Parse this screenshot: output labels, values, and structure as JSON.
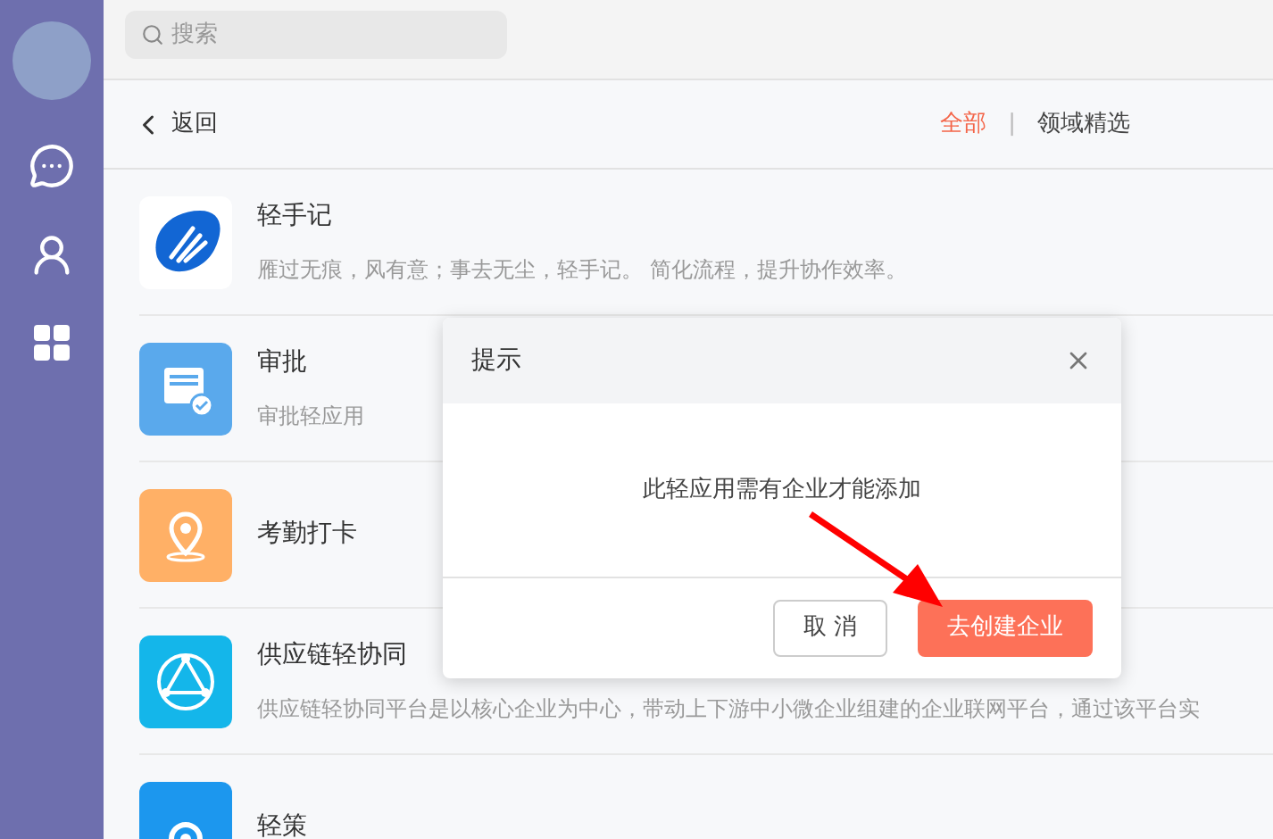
{
  "search": {
    "placeholder": "搜索"
  },
  "nav": {
    "back": "返回",
    "tabs": [
      {
        "label": "全部",
        "selected": true
      },
      {
        "label": "领域精选",
        "selected": false
      }
    ],
    "separator": "|"
  },
  "apps": [
    {
      "name": "轻手记",
      "description": "雁过无痕，风有意；事去无尘，轻手记。 简化流程，提升协作效率。"
    },
    {
      "name": "审批",
      "description": "审批轻应用"
    },
    {
      "name": "考勤打卡"
    },
    {
      "name": "供应链轻协同",
      "description": "供应链轻协同平台是以核心企业为中心，带动上下游中小微企业组建的企业联网平台，通过该平台实"
    },
    {
      "name": "轻策"
    }
  ],
  "dialog": {
    "title": "提示",
    "message": "此轻应用需有企业才能添加",
    "buttons": [
      {
        "label": "取 消",
        "kind": "secondary"
      },
      {
        "label": "去创建企业",
        "kind": "primary"
      }
    ]
  }
}
